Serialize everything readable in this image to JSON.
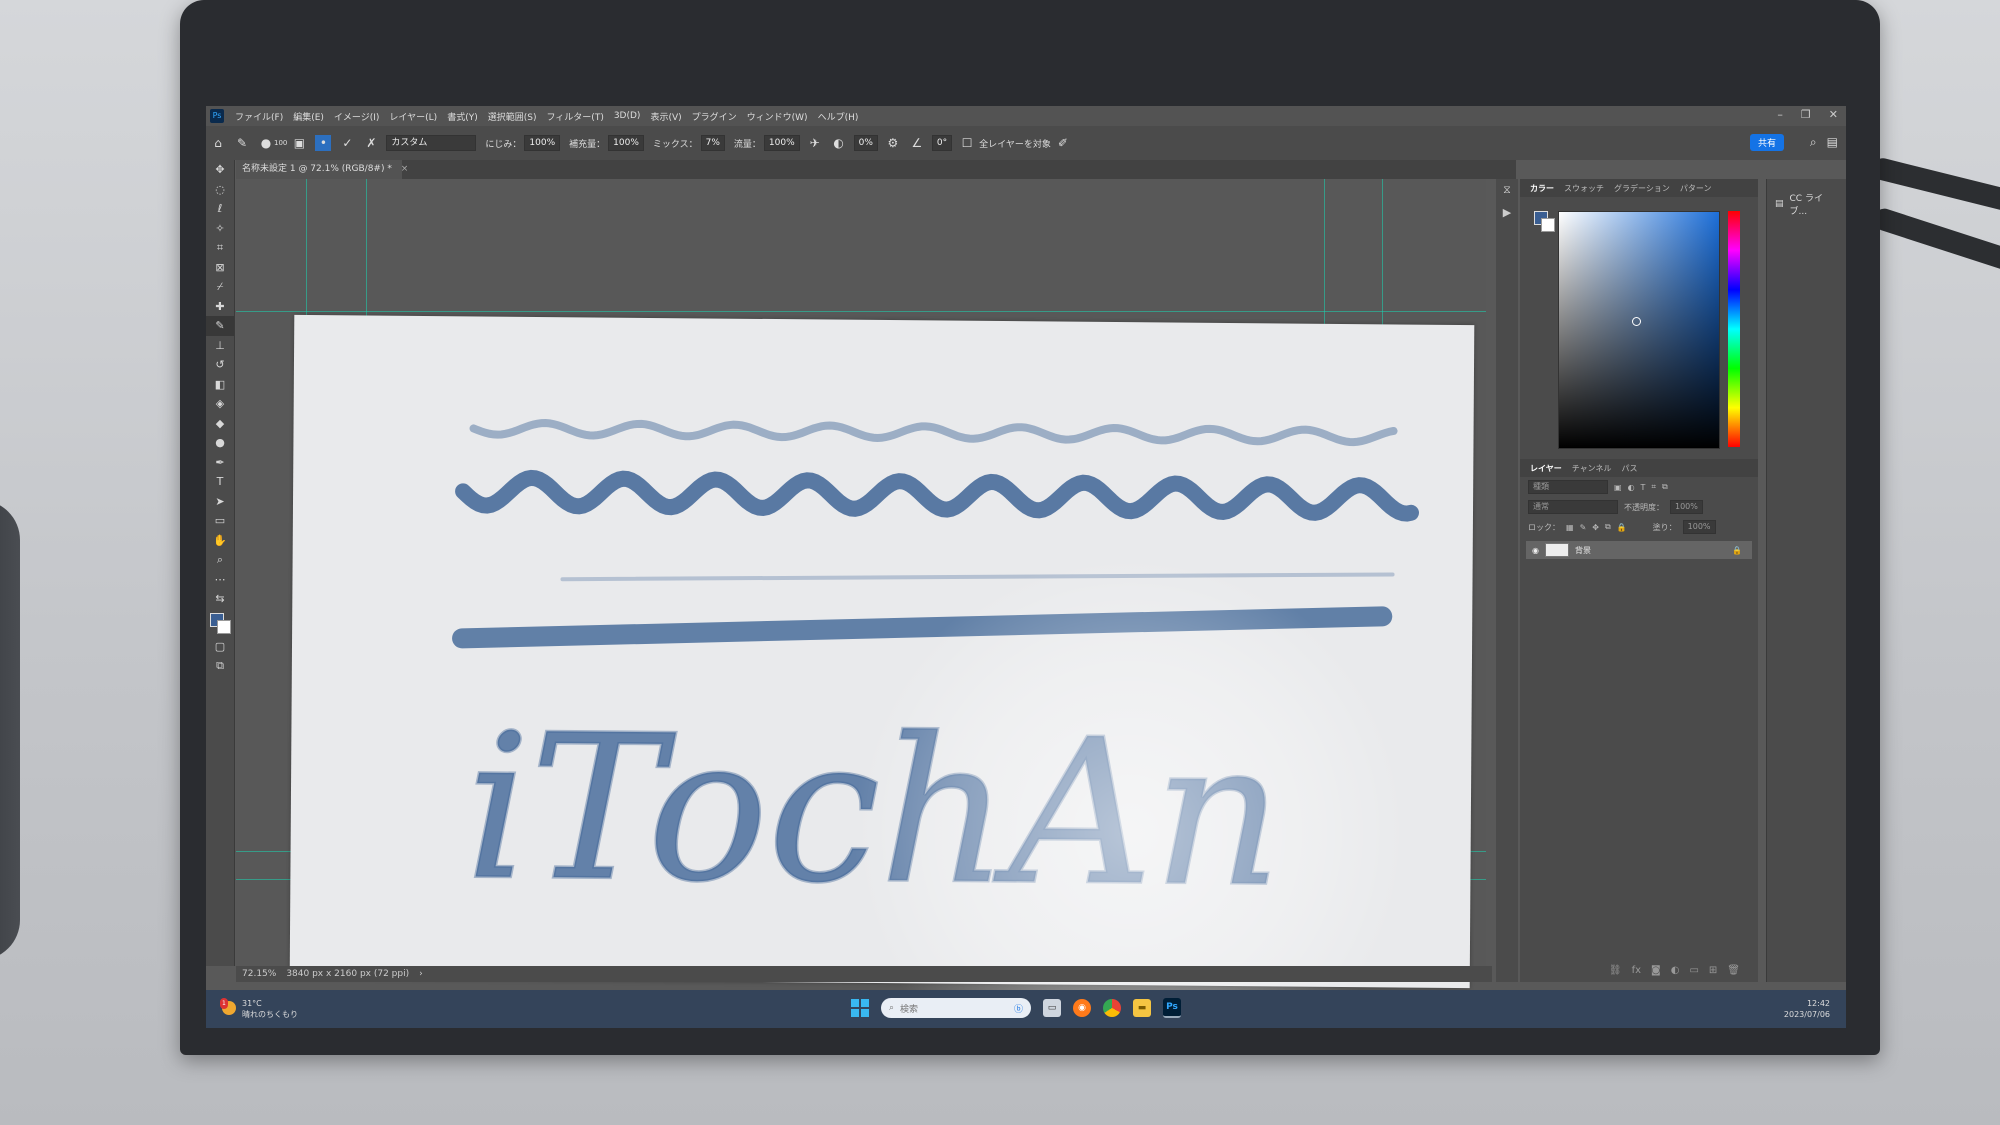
{
  "menubar": {
    "ps": "Ps",
    "items": [
      "ファイル(F)",
      "編集(E)",
      "イメージ(I)",
      "レイヤー(L)",
      "書式(Y)",
      "選択範囲(S)",
      "フィルター(T)",
      "3D(D)",
      "表示(V)",
      "プラグイン",
      "ウィンドウ(W)",
      "ヘルプ(H)"
    ]
  },
  "optbar": {
    "brush_size": "100",
    "preset": "カスタム",
    "wet_label": "にじみ：",
    "wet_value": "100%",
    "load_label": "補充量：",
    "load_value": "100%",
    "mix_label": "ミックス：",
    "mix_value": "7%",
    "flow_label": "流量：",
    "flow_value": "100%",
    "smooth_value": "0%",
    "angle_value": "0°",
    "sample_all": "全レイヤーを対象",
    "share": "共有"
  },
  "document": {
    "tab_title": "名称未設定 1 @ 72.1% (RGB/8#) *",
    "art_text": "iTochAn"
  },
  "statusbar": {
    "zoom": "72.15%",
    "dims": "3840 px x 2160 px (72 ppi)",
    "arrow": "›"
  },
  "panels": {
    "color_tabs": [
      "カラー",
      "スウォッチ",
      "グラデーション",
      "パターン"
    ],
    "layer_tabs": [
      "レイヤー",
      "チャンネル",
      "パス"
    ],
    "kind_placeholder": "種類",
    "blend_mode": "通常",
    "opacity_label": "不透明度：",
    "opacity_value": "100%",
    "lock_label": "ロック：",
    "fill_label": "塗り：",
    "fill_value": "100%",
    "layer_name": "背景",
    "cc_label": "CC ライブ..."
  },
  "taskbar": {
    "temp": "31°C",
    "weather": "晴れのちくもり",
    "search_placeholder": "検索",
    "ps_label": "Ps",
    "time": "12:42",
    "date": "2023/07/06",
    "badge": "1"
  },
  "colors": {
    "accent": "#1473e6",
    "foreground": "#3a5e92",
    "brush_stroke": "#3f6596"
  }
}
